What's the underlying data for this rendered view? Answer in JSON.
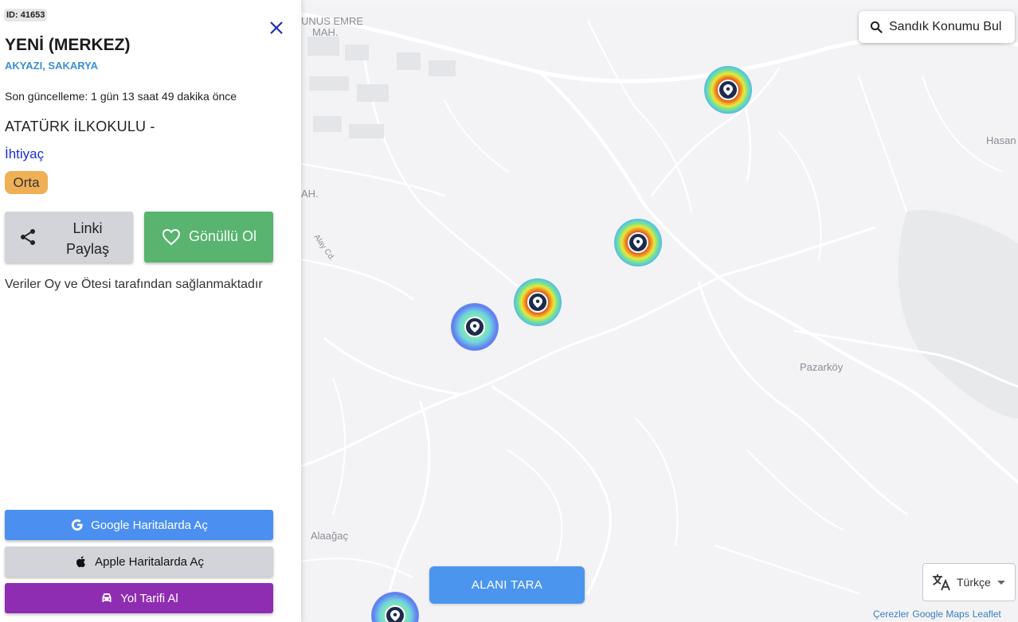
{
  "sidebar": {
    "id_badge": "ID: 41653",
    "title": "YENİ (MERKEZ)",
    "subtitle": "AKYAZI, SAKARYA",
    "updated": "Son güncelleme: 1 gün 13 saat 49 dakika önce",
    "school": "ATATÜRK İLKOKULU -",
    "need_label": "İhtiyaç",
    "need_level": "Orta",
    "share_label": "Linki Paylaş",
    "volunteer_label": "Gönüllü Ol",
    "source": "Veriler Oy ve Ötesi tarafından sağlanmaktadır",
    "google_maps_label": "Google Haritalarda Aç",
    "apple_maps_label": "Apple Haritalarda Aç",
    "route_label": "Yol Tarifi Al",
    "colors": {
      "need_badge": "#f0b056",
      "volunteer": "#58b46f",
      "google": "#4b8ff0",
      "route": "#8f2db2",
      "subtitle": "#3b8fd8"
    }
  },
  "map": {
    "search_label": "Sandık Konumu Bul",
    "scan_label": "ALANI TARA",
    "language": "Türkçe",
    "labels": {
      "yunus_emre_1": "UNUS EMRE",
      "yunus_emre_2": "MAH.",
      "mah_fragment": "AH.",
      "street": "Alay Cd.",
      "hasan": "Hasan",
      "pazarkoy": "Pazarköy",
      "alaagac": "Alaağaç"
    },
    "markers": [
      {
        "heat": "hot",
        "icon": "location-pin-icon"
      },
      {
        "heat": "hot",
        "icon": "location-pin-icon"
      },
      {
        "heat": "hot",
        "icon": "location-pin-icon"
      },
      {
        "heat": "cool",
        "icon": "location-pin-icon"
      },
      {
        "heat": "cool",
        "icon": "location-pin-icon"
      }
    ],
    "attribution": {
      "cookies": "Çerezler",
      "google_maps": "Google Maps",
      "leaflet": "Leaflet"
    }
  }
}
